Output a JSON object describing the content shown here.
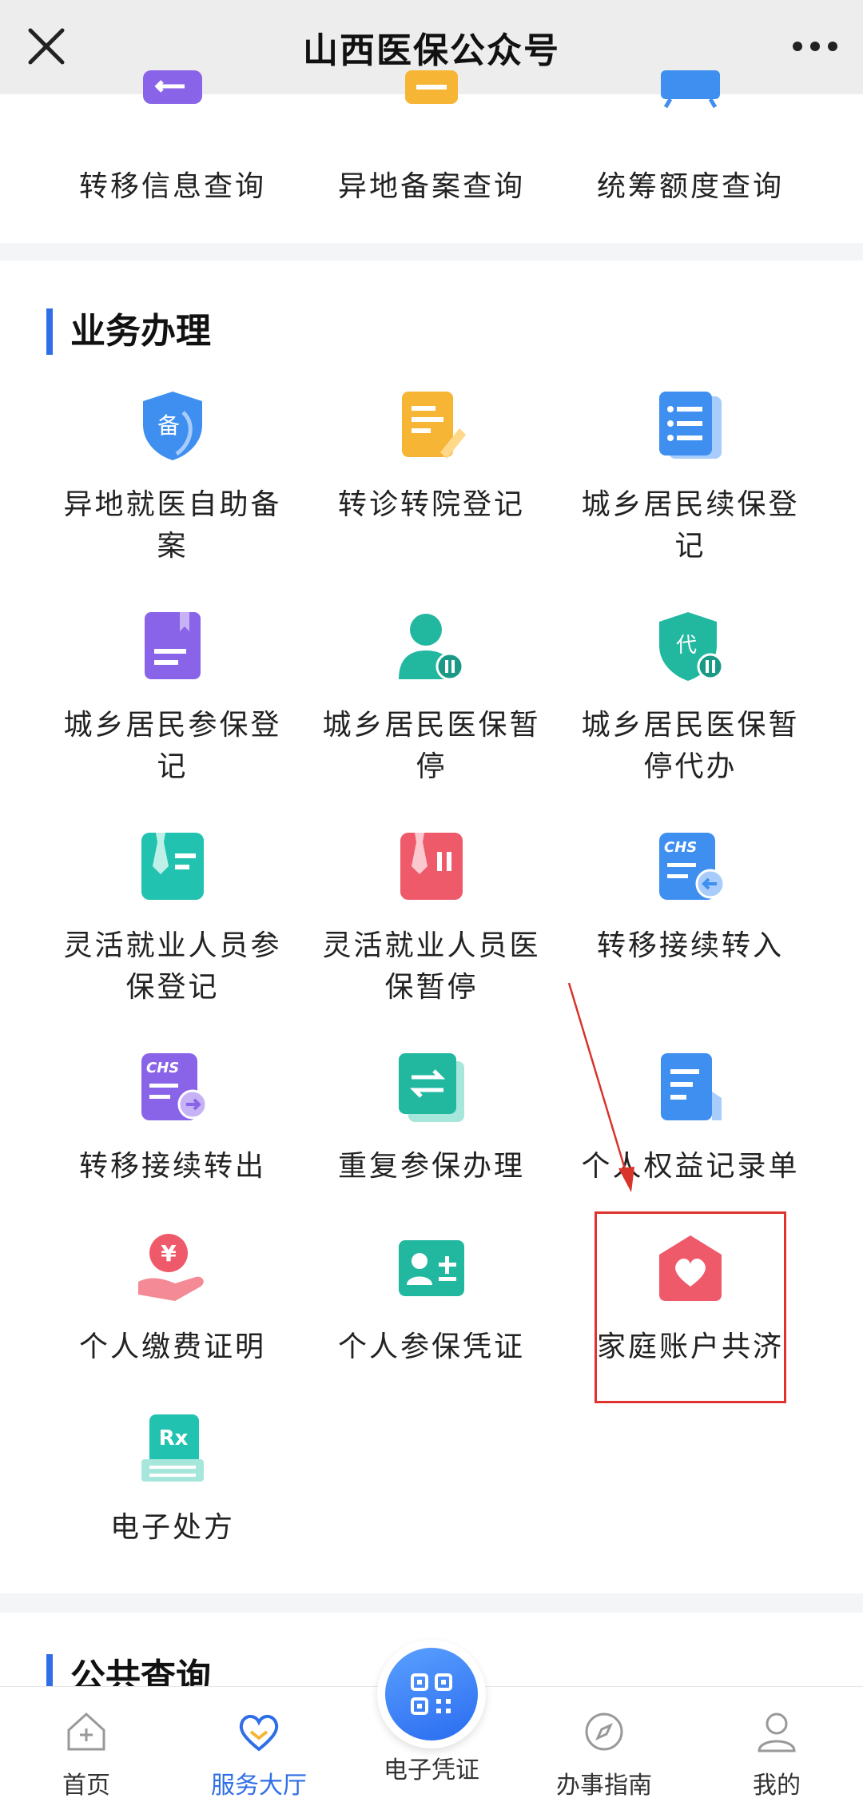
{
  "header": {
    "title": "山西医保公众号"
  },
  "top_items": [
    {
      "label": "转移信息查询",
      "icon": "transfer-info-icon",
      "color": "#8a64e8"
    },
    {
      "label": "异地备案查询",
      "icon": "remote-record-icon",
      "color": "#f6b534"
    },
    {
      "label": "统筹额度查询",
      "icon": "quota-query-icon",
      "color": "#3e8ff0"
    }
  ],
  "business": {
    "title": "业务办理",
    "items": [
      {
        "label": "异地就医自助备案",
        "icon": "shield-bei-icon",
        "glyph": "备",
        "color": "#3e8ff0"
      },
      {
        "label": "转诊转院登记",
        "icon": "edit-doc-icon",
        "glyph": "",
        "color": "#f6b534"
      },
      {
        "label": "城乡居民续保登记",
        "icon": "list-doc-icon",
        "glyph": "",
        "color": "#3e8ff0"
      },
      {
        "label": "城乡居民参保登记",
        "icon": "book-icon",
        "glyph": "",
        "color": "#8a64e8"
      },
      {
        "label": "城乡居民医保暂停",
        "icon": "person-pause-icon",
        "glyph": "",
        "color": "#22b8a0"
      },
      {
        "label": "城乡居民医保暂停代办",
        "icon": "shield-dai-icon",
        "glyph": "代",
        "color": "#22b8a0"
      },
      {
        "label": "灵活就业人员参保登记",
        "icon": "tie-doc-icon",
        "glyph": "",
        "color": "#22c2b0"
      },
      {
        "label": "灵活就业人员医保暂停",
        "icon": "tie-pause-icon",
        "glyph": "",
        "color": "#ef5a6a"
      },
      {
        "label": "转移接续转入",
        "icon": "chs-in-icon",
        "glyph": "CHS",
        "color": "#3e8ff0"
      },
      {
        "label": "转移接续转出",
        "icon": "chs-out-icon",
        "glyph": "CHS",
        "color": "#8a64e8"
      },
      {
        "label": "重复参保办理",
        "icon": "repeat-icon",
        "glyph": "",
        "color": "#22b8a0"
      },
      {
        "label": "个人权益记录单",
        "icon": "record-doc-icon",
        "glyph": "",
        "color": "#3e8ff0"
      },
      {
        "label": "个人缴费证明",
        "icon": "yen-hand-icon",
        "glyph": "¥",
        "color": "#ef5a6a"
      },
      {
        "label": "个人参保凭证",
        "icon": "id-card-icon",
        "glyph": "",
        "color": "#22b8a0"
      },
      {
        "label": "家庭账户共济",
        "icon": "house-heart-icon",
        "glyph": "",
        "color": "#ef5a6a"
      },
      {
        "label": "电子处方",
        "icon": "rx-icon",
        "glyph": "Rx",
        "color": "#22c2b0"
      }
    ]
  },
  "public": {
    "title": "公共查询"
  },
  "tabbar": {
    "items": [
      {
        "label": "首页",
        "icon": "home-icon"
      },
      {
        "label": "服务大厅",
        "icon": "heart-icon",
        "active": true
      },
      {
        "label": "电子凭证",
        "icon": "qr-code-icon"
      },
      {
        "label": "办事指南",
        "icon": "compass-icon"
      },
      {
        "label": "我的",
        "icon": "user-icon"
      }
    ]
  },
  "colors": {
    "accent": "#2f6ee6",
    "highlight": "#e0322e",
    "annotation_arrow": "#d9342b"
  }
}
